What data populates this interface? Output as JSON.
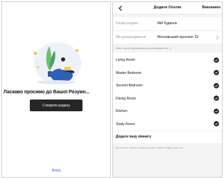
{
  "welcome_screen": {
    "title": "Ласкаво просимо до Вашої Розумн...",
    "create_button_label": "Створити родину",
    "exit_link_label": "Вихід"
  },
  "home_screen": {
    "nav": {
      "title": "Додати Оселю",
      "done_label": "Виконано"
    },
    "fields": [
      {
        "label": "Назва родини",
        "value": "Мій будинок"
      },
      {
        "label": "Місцезнаходження",
        "value": "Московський проспект 33"
      }
    ],
    "rooms_caption": "Вміст простору/кімнати (розташування в...)",
    "rooms": [
      {
        "label": "Living Room",
        "checked": true
      },
      {
        "label": "Master Bedroom",
        "checked": true
      },
      {
        "label": "Second Bedroom",
        "checked": true
      },
      {
        "label": "Dining Room",
        "checked": true
      },
      {
        "label": "Kitchen",
        "checked": true
      },
      {
        "label": "Study Room",
        "checked": true
      }
    ],
    "add_room_label": "Додати іншу кімнату",
    "bottom_note": "Ви можете змінити налаштування пізніше в будь-який час"
  },
  "colors": {
    "primary_button": "#262626",
    "link": "#3a6fd8",
    "check": "#1f1f1f",
    "illustration_blue": "#2f5fb8",
    "illustration_green": "#6fbf73"
  }
}
